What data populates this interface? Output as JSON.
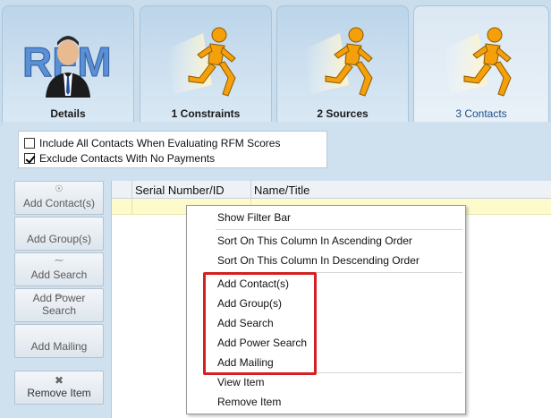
{
  "tabs": [
    {
      "label": "Details",
      "icon": "rfm-logo-icon",
      "logo_text": "RFM"
    },
    {
      "label": "1 Constraints",
      "icon": "running-man-icon"
    },
    {
      "label": "2 Sources",
      "icon": "running-man-icon"
    },
    {
      "label": "3 Contacts",
      "icon": "running-man-icon"
    }
  ],
  "options": {
    "include_all": {
      "label": "Include All Contacts When Evaluating RFM Scores",
      "checked": false
    },
    "exclude_no_payments": {
      "label": "Exclude Contacts With No Payments",
      "checked": true
    }
  },
  "buttons": [
    {
      "label": "Add Contact(s)",
      "icon": "add-contact-icon"
    },
    {
      "label": "Add Group(s)",
      "icon": "add-group-icon"
    },
    {
      "label": "Add Search",
      "icon": "add-search-icon"
    },
    {
      "label": "Add Power Search",
      "icon": "add-power-search-icon"
    },
    {
      "label": "Add Mailing",
      "icon": "add-mailing-icon"
    },
    {
      "label": "Remove Item",
      "icon": "remove-icon"
    }
  ],
  "grid": {
    "columns": [
      "Serial Number/ID",
      "Name/Title"
    ]
  },
  "context_menu": {
    "items": [
      "Show Filter Bar",
      "Sort On This Column In Ascending Order",
      "Sort On This Column In Descending Order",
      "Add Contact(s)",
      "Add Group(s)",
      "Add Search",
      "Add Power Search",
      "Add Mailing",
      "View Item",
      "Remove Item"
    ]
  },
  "colors": {
    "highlight": "#d42020",
    "active_tab_text": "#1f4e8c",
    "running_man": "#f5a00a"
  }
}
